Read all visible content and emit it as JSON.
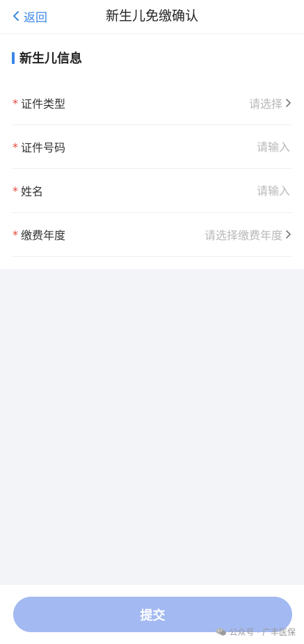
{
  "navbar": {
    "back_label": "返回",
    "title": "新生儿免缴确认"
  },
  "section": {
    "title": "新生儿信息"
  },
  "form": {
    "rows": [
      {
        "required": "*",
        "label": "证件类型",
        "placeholder": "请选择",
        "type": "select"
      },
      {
        "required": "*",
        "label": "证件号码",
        "placeholder": "请输入",
        "type": "input"
      },
      {
        "required": "*",
        "label": "姓名",
        "placeholder": "请输入",
        "type": "input"
      },
      {
        "required": "*",
        "label": "缴费年度",
        "placeholder": "请选择缴费年度",
        "type": "select"
      }
    ]
  },
  "submit": {
    "label": "提交"
  },
  "watermark": {
    "text": "公众号 · 广丰医保"
  },
  "colors": {
    "accent": "#3a86e8",
    "required": "#e5483b",
    "submit_bg": "#a3b9f2",
    "background": "#f3f4f8"
  }
}
